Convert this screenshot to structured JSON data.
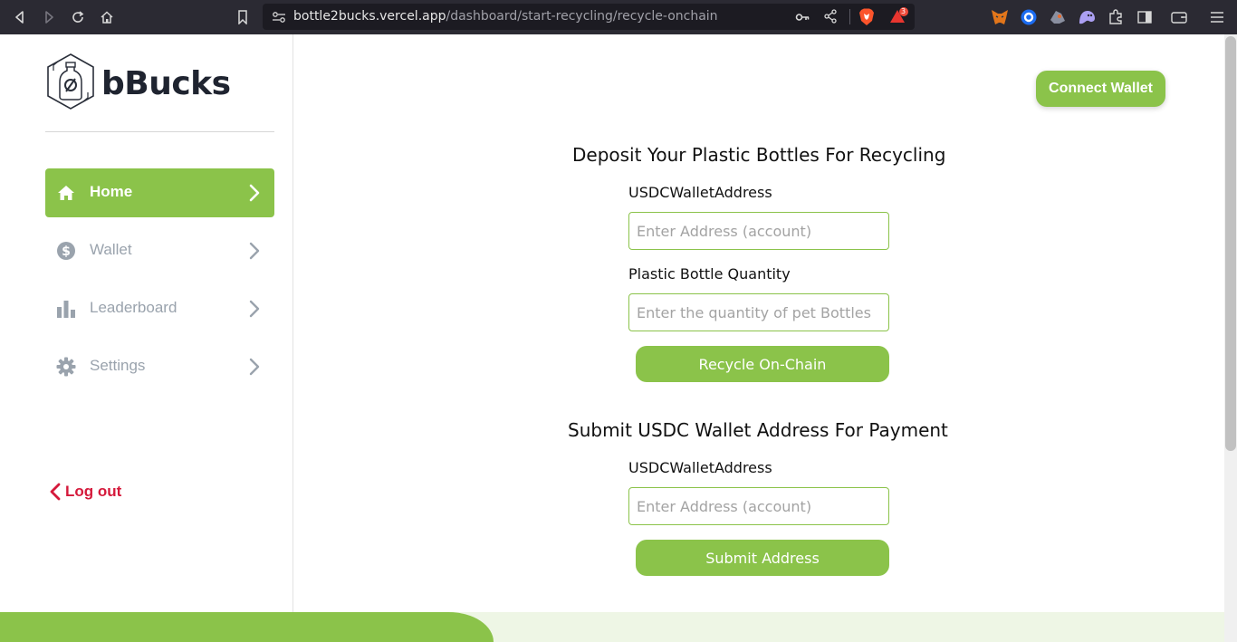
{
  "browser": {
    "url_host": "bottle2bucks.vercel.app",
    "url_path": "/dashboard/start-recycling/recycle-onchain",
    "notification_count": "3"
  },
  "sidebar": {
    "brand": "bBucks",
    "items": [
      {
        "label": "Home",
        "icon": "home-icon",
        "active": true
      },
      {
        "label": "Wallet",
        "icon": "dollar-circle-icon",
        "active": false
      },
      {
        "label": "Leaderboard",
        "icon": "bar-chart-icon",
        "active": false
      },
      {
        "label": "Settings",
        "icon": "gear-icon",
        "active": false
      }
    ],
    "logout_label": "Log out"
  },
  "header": {
    "connect_wallet_label": "Connect Wallet"
  },
  "recycle_form": {
    "title": "Deposit Your Plastic Bottles For Recycling",
    "wallet_label": "USDCWalletAddress",
    "wallet_placeholder": "Enter Address (account)",
    "quantity_label": "Plastic Bottle Quantity",
    "quantity_placeholder": "Enter the quantity of pet Bottles",
    "submit_label": "Recycle On-Chain"
  },
  "payment_form": {
    "title": "Submit USDC Wallet Address For Payment",
    "wallet_label": "USDCWalletAddress",
    "wallet_placeholder": "Enter Address (account)",
    "submit_label": "Submit Address"
  },
  "colors": {
    "accent": "#8bc34a",
    "logout": "#d5193b",
    "muted_text": "#9aa3ad"
  }
}
